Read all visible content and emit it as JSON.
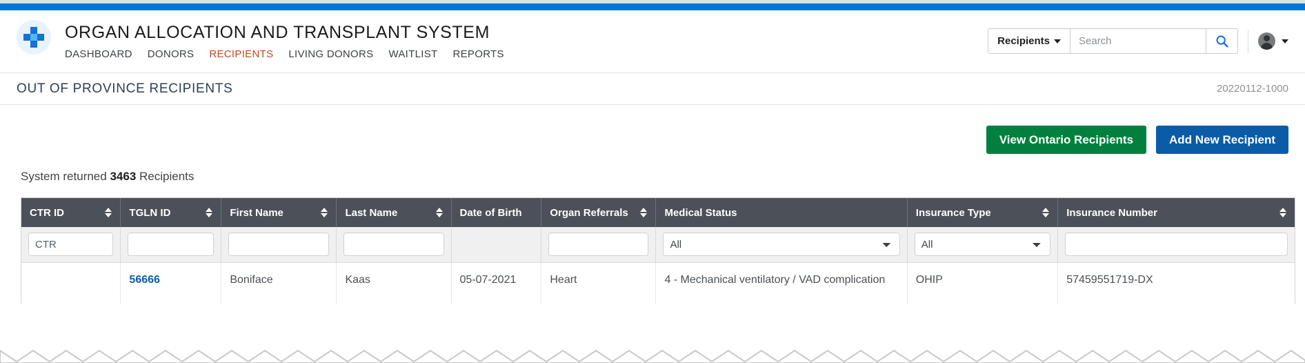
{
  "topbar": {
    "accent_color": "#0078d7"
  },
  "header": {
    "logo_icon": "medical-cross-icon",
    "app_title": "ORGAN ALLOCATION AND TRANSPLANT SYSTEM",
    "nav": [
      {
        "label": "DASHBOARD",
        "active": false
      },
      {
        "label": "DONORS",
        "active": false
      },
      {
        "label": "RECIPIENTS",
        "active": true
      },
      {
        "label": "LIVING DONORS",
        "active": false
      },
      {
        "label": "WAITLIST",
        "active": false
      },
      {
        "label": "REPORTS",
        "active": false
      }
    ],
    "active_nav_color": "#c04a1e",
    "search": {
      "scope_label": "Recipients",
      "scope_caret_icon": "caret-down-icon",
      "placeholder": "Search",
      "value": "",
      "search_icon": "search-icon",
      "search_icon_color": "#1a73e8"
    },
    "account": {
      "avatar_icon": "user-avatar-icon",
      "caret_icon": "caret-down-icon"
    }
  },
  "page_bar": {
    "title": "OUT OF PROVINCE RECIPIENTS",
    "reference": "20220112-1000"
  },
  "actions": {
    "view_ontario_label": "View Ontario Recipients",
    "view_ontario_color": "#00803e",
    "add_new_label": "Add New Recipient",
    "add_new_color": "#0a5ca6"
  },
  "results": {
    "prefix": "System returned",
    "count": "3463",
    "suffix": "Recipients"
  },
  "table": {
    "columns": [
      {
        "label": "CTR ID",
        "sortable": true,
        "filter": "text",
        "filter_value": "CTR"
      },
      {
        "label": "TGLN ID",
        "sortable": true,
        "filter": "text",
        "filter_value": ""
      },
      {
        "label": "First Name",
        "sortable": true,
        "filter": "text",
        "filter_value": ""
      },
      {
        "label": "Last Name",
        "sortable": true,
        "filter": "text",
        "filter_value": ""
      },
      {
        "label": "Date of Birth",
        "sortable": false,
        "filter": "none",
        "filter_value": ""
      },
      {
        "label": "Organ Referrals",
        "sortable": true,
        "filter": "text",
        "filter_value": ""
      },
      {
        "label": "Medical Status",
        "sortable": false,
        "filter": "select",
        "filter_value": "All"
      },
      {
        "label": "Insurance Type",
        "sortable": true,
        "filter": "select",
        "filter_value": "All"
      },
      {
        "label": "Insurance Number",
        "sortable": true,
        "filter": "text",
        "filter_value": ""
      }
    ],
    "select_options": [
      "All"
    ],
    "rows": [
      {
        "ctr_id": "",
        "tgln_id": "56666",
        "first_name": "Boniface",
        "last_name": "Kaas",
        "date_of_birth": "05-07-2021",
        "organ_referrals": "Heart",
        "medical_status": "4 - Mechanical ventilatory / VAD complication",
        "insurance_type": "OHIP",
        "insurance_number": "57459551719-DX"
      }
    ]
  }
}
